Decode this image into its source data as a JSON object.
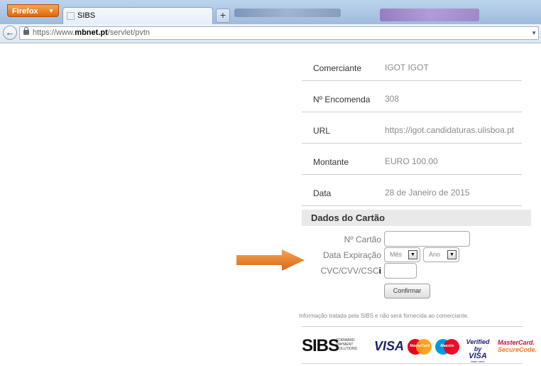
{
  "browser": {
    "app_button": "Firefox",
    "tab_title": "SIBS",
    "new_tab_label": "+",
    "url_prefix": "https://www.",
    "url_domain": "mbnet.pt",
    "url_path": "/servlet/pvtn"
  },
  "order": {
    "rows": [
      {
        "label": "Comerciante",
        "value": "IGOT IGOT"
      },
      {
        "label": "Nº Encomenda",
        "value": "308"
      },
      {
        "label": "URL",
        "value": "https://igot.candidaturas.ulisboa.pt"
      },
      {
        "label": "Montante",
        "value": "EURO 100.00"
      },
      {
        "label": "Data",
        "value": "28 de Janeiro de 2015"
      }
    ]
  },
  "card": {
    "section_title": "Dados do Cartão",
    "card_number_label": "Nº Cartão",
    "card_number_value": "",
    "expiry_label": "Data Expiração",
    "month_placeholder": "Mês",
    "year_placeholder": "Ano",
    "cvc_label": "CVC/CVV/CSC",
    "cvc_info": "i",
    "cvc_value": "",
    "confirm_label": "Confirmar"
  },
  "footer": {
    "notice": "Informação tratada pela SIBS e não será fornecida ao comerciante.",
    "sibs_logo": "SIBS",
    "sibs_tagline_1": "FORWARD",
    "sibs_tagline_2": "PAYMENT",
    "sibs_tagline_3": "SOLUTIONS",
    "visa_logo": "VISA",
    "mastercard_logo": "MasterCard",
    "maestro_logo": "Maestro",
    "verified_by": "Verified by",
    "verified_visa": "VISA",
    "learn_more": "learn more",
    "mc_securecode_1": "MasterCard.",
    "mc_securecode_2": "SecureCode."
  },
  "colors": {
    "arrow": "#e8822a",
    "firefox_button": "#e0660f",
    "visa_blue": "#1a1f71",
    "mc_red": "#eb001b",
    "mc_orange": "#f79e1b"
  }
}
